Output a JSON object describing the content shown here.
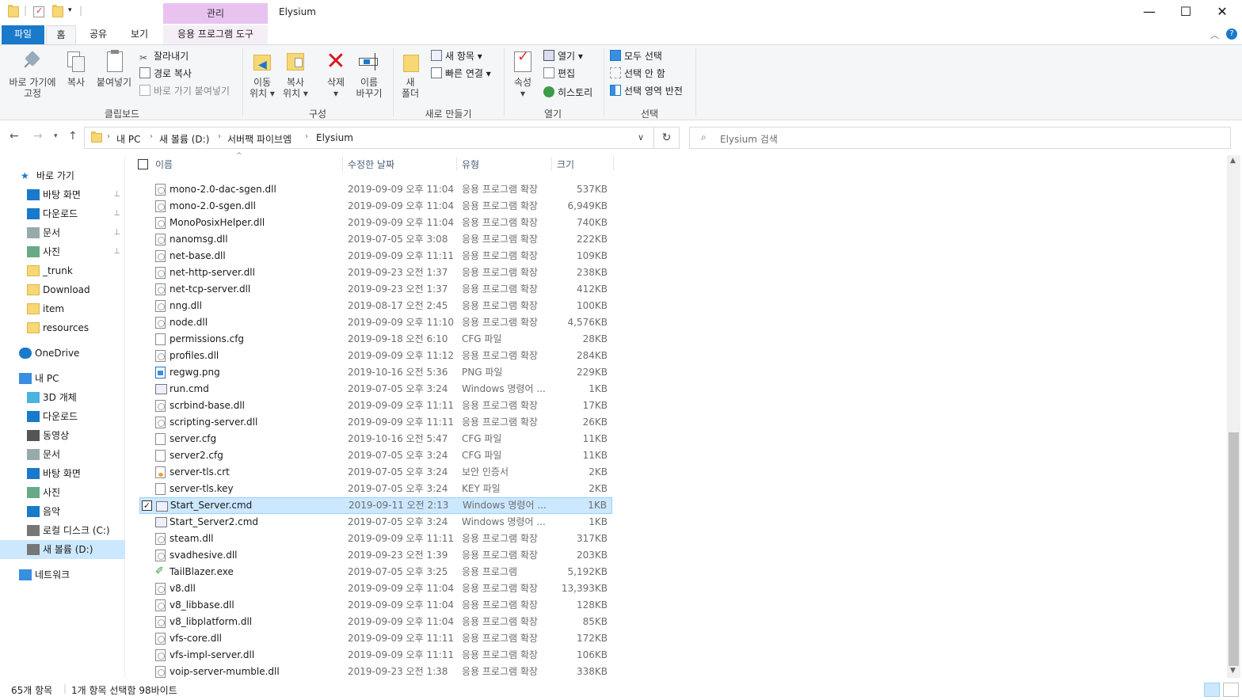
{
  "window": {
    "title": "Elysium",
    "context_group": "관리",
    "min": "—",
    "max": "☐",
    "close": "✕"
  },
  "tabs": {
    "file": "파일",
    "home": "홈",
    "share": "공유",
    "view": "보기",
    "apptools": "응용 프로그램 도구"
  },
  "ribbon": {
    "pin_label1": "바로 가기에",
    "pin_label2": "고정",
    "copy": "복사",
    "paste": "붙여넣기",
    "cut": "잘라내기",
    "copy_path": "경로 복사",
    "paste_shortcut": "바로 가기 붙여넣기",
    "group_clipboard": "클립보드",
    "move1": "이동",
    "move2": "위치 ▾",
    "copyto1": "복사",
    "copyto2": "위치 ▾",
    "delete1": "삭제",
    "delete2": "▾",
    "rename1": "이름",
    "rename2": "바꾸기",
    "group_organize": "구성",
    "newfolder1": "새",
    "newfolder2": "폴더",
    "new_item": "새 항목 ▾",
    "easy_access": "빠른 연결 ▾",
    "group_new": "새로 만들기",
    "props1": "속성",
    "props2": "▾",
    "open": "열기 ▾",
    "edit": "편집",
    "history": "히스토리",
    "group_open": "열기",
    "select_all": "모두 선택",
    "select_none": "선택 안 함",
    "invert": "선택 영역 반전",
    "group_select": "선택"
  },
  "address": {
    "crumbs": [
      "내 PC",
      "새 볼륨 (D:)",
      "서버팩 파이브엠",
      "Elysium"
    ],
    "search_placeholder": "Elysium 검색"
  },
  "nav": {
    "items": [
      {
        "label": "바로 가기",
        "icon": "star-icon"
      },
      {
        "label": "바탕 화면",
        "icon": "desktop-icon"
      },
      {
        "label": "다운로드",
        "icon": "download-icon"
      },
      {
        "label": "문서",
        "icon": "document-icon"
      },
      {
        "label": "사진",
        "icon": "picture-icon"
      },
      {
        "label": "_trunk",
        "icon": "folder-icon"
      },
      {
        "label": "Download",
        "icon": "folder-icon"
      },
      {
        "label": "item",
        "icon": "folder-icon"
      },
      {
        "label": "resources",
        "icon": "folder-icon"
      },
      {
        "label": "OneDrive",
        "icon": "cloud-icon"
      },
      {
        "label": "내 PC",
        "icon": "pc-icon"
      },
      {
        "label": "3D 개체",
        "icon": "cube-icon"
      },
      {
        "label": "다운로드",
        "icon": "download-icon"
      },
      {
        "label": "동영상",
        "icon": "video-icon"
      },
      {
        "label": "문서",
        "icon": "document-icon"
      },
      {
        "label": "바탕 화면",
        "icon": "desktop-icon"
      },
      {
        "label": "사진",
        "icon": "picture-icon"
      },
      {
        "label": "음악",
        "icon": "music-icon"
      },
      {
        "label": "로컬 디스크 (C:)",
        "icon": "drive-icon"
      },
      {
        "label": "새 볼륨 (D:)",
        "icon": "drive-icon"
      },
      {
        "label": "네트워크",
        "icon": "network-icon"
      }
    ]
  },
  "columns": {
    "name": "이름",
    "date": "수정한 날짜",
    "type": "유형",
    "size": "크기"
  },
  "files": [
    {
      "name": "mono-2.0-dac-sgen.dll",
      "date": "2019-09-09 오후 11:04",
      "type": "응용 프로그램 확장",
      "size": "537KB",
      "kind": "dll"
    },
    {
      "name": "mono-2.0-sgen.dll",
      "date": "2019-09-09 오후 11:04",
      "type": "응용 프로그램 확장",
      "size": "6,949KB",
      "kind": "dll"
    },
    {
      "name": "MonoPosixHelper.dll",
      "date": "2019-09-09 오후 11:04",
      "type": "응용 프로그램 확장",
      "size": "740KB",
      "kind": "dll"
    },
    {
      "name": "nanomsg.dll",
      "date": "2019-07-05 오후 3:08",
      "type": "응용 프로그램 확장",
      "size": "222KB",
      "kind": "dll"
    },
    {
      "name": "net-base.dll",
      "date": "2019-09-09 오후 11:11",
      "type": "응용 프로그램 확장",
      "size": "109KB",
      "kind": "dll"
    },
    {
      "name": "net-http-server.dll",
      "date": "2019-09-23 오전 1:37",
      "type": "응용 프로그램 확장",
      "size": "238KB",
      "kind": "dll"
    },
    {
      "name": "net-tcp-server.dll",
      "date": "2019-09-23 오전 1:37",
      "type": "응용 프로그램 확장",
      "size": "412KB",
      "kind": "dll"
    },
    {
      "name": "nng.dll",
      "date": "2019-08-17 오전 2:45",
      "type": "응용 프로그램 확장",
      "size": "100KB",
      "kind": "dll"
    },
    {
      "name": "node.dll",
      "date": "2019-09-09 오후 11:10",
      "type": "응용 프로그램 확장",
      "size": "4,576KB",
      "kind": "dll"
    },
    {
      "name": "permissions.cfg",
      "date": "2019-09-18 오전 6:10",
      "type": "CFG 파일",
      "size": "28KB",
      "kind": "cfg"
    },
    {
      "name": "profiles.dll",
      "date": "2019-09-09 오후 11:12",
      "type": "응용 프로그램 확장",
      "size": "284KB",
      "kind": "dll"
    },
    {
      "name": "regwg.png",
      "date": "2019-10-16 오전 5:36",
      "type": "PNG 파일",
      "size": "229KB",
      "kind": "png"
    },
    {
      "name": "run.cmd",
      "date": "2019-07-05 오후 3:24",
      "type": "Windows 명령어 ...",
      "size": "1KB",
      "kind": "cmd"
    },
    {
      "name": "scrbind-base.dll",
      "date": "2019-09-09 오후 11:11",
      "type": "응용 프로그램 확장",
      "size": "17KB",
      "kind": "dll"
    },
    {
      "name": "scripting-server.dll",
      "date": "2019-09-09 오후 11:11",
      "type": "응용 프로그램 확장",
      "size": "26KB",
      "kind": "dll"
    },
    {
      "name": "server.cfg",
      "date": "2019-10-16 오전 5:47",
      "type": "CFG 파일",
      "size": "11KB",
      "kind": "cfg"
    },
    {
      "name": "server2.cfg",
      "date": "2019-07-05 오후 3:24",
      "type": "CFG 파일",
      "size": "11KB",
      "kind": "cfg"
    },
    {
      "name": "server-tls.crt",
      "date": "2019-07-05 오후 3:24",
      "type": "보안 인증서",
      "size": "2KB",
      "kind": "crt"
    },
    {
      "name": "server-tls.key",
      "date": "2019-07-05 오후 3:24",
      "type": "KEY 파일",
      "size": "2KB",
      "kind": "cfg"
    },
    {
      "name": "Start_Server.cmd",
      "date": "2019-09-11 오전 2:13",
      "type": "Windows 명령어 ...",
      "size": "1KB",
      "kind": "cmd",
      "selected": true
    },
    {
      "name": "Start_Server2.cmd",
      "date": "2019-07-05 오후 3:24",
      "type": "Windows 명령어 ...",
      "size": "1KB",
      "kind": "cmd"
    },
    {
      "name": "steam.dll",
      "date": "2019-09-09 오후 11:11",
      "type": "응용 프로그램 확장",
      "size": "317KB",
      "kind": "dll"
    },
    {
      "name": "svadhesive.dll",
      "date": "2019-09-23 오전 1:39",
      "type": "응용 프로그램 확장",
      "size": "203KB",
      "kind": "dll"
    },
    {
      "name": "TailBlazer.exe",
      "date": "2019-07-05 오후 3:25",
      "type": "응용 프로그램",
      "size": "5,192KB",
      "kind": "exe"
    },
    {
      "name": "v8.dll",
      "date": "2019-09-09 오후 11:04",
      "type": "응용 프로그램 확장",
      "size": "13,393KB",
      "kind": "dll"
    },
    {
      "name": "v8_libbase.dll",
      "date": "2019-09-09 오후 11:04",
      "type": "응용 프로그램 확장",
      "size": "128KB",
      "kind": "dll"
    },
    {
      "name": "v8_libplatform.dll",
      "date": "2019-09-09 오후 11:04",
      "type": "응용 프로그램 확장",
      "size": "85KB",
      "kind": "dll"
    },
    {
      "name": "vfs-core.dll",
      "date": "2019-09-09 오후 11:11",
      "type": "응용 프로그램 확장",
      "size": "172KB",
      "kind": "dll"
    },
    {
      "name": "vfs-impl-server.dll",
      "date": "2019-09-09 오후 11:11",
      "type": "응용 프로그램 확장",
      "size": "106KB",
      "kind": "dll"
    },
    {
      "name": "voip-server-mumble.dll",
      "date": "2019-09-23 오전 1:38",
      "type": "응용 프로그램 확장",
      "size": "338KB",
      "kind": "dll"
    }
  ],
  "status": {
    "count": "65개 항목",
    "selection": "1개 항목 선택함 98바이트"
  },
  "colors": {
    "accent": "#1979ca",
    "selection": "#cce8ff",
    "context": "#e8c3f0"
  }
}
